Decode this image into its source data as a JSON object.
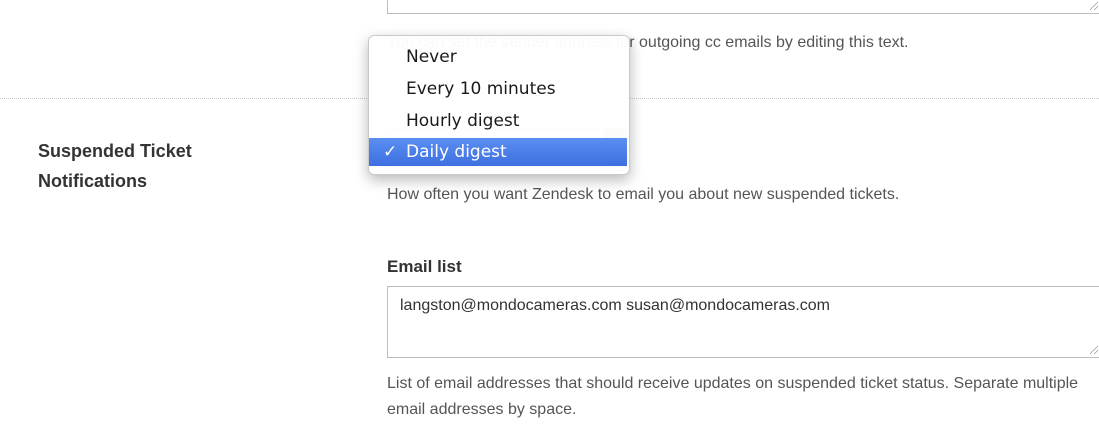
{
  "cc_help_text": "You can set the sender address for outgoing cc emails by editing this text.",
  "section_label": "Suspended Ticket Notifications",
  "notification_select": {
    "options": [
      {
        "label": "Never",
        "selected": false
      },
      {
        "label": "Every 10 minutes",
        "selected": false
      },
      {
        "label": "Hourly digest",
        "selected": false
      },
      {
        "label": "Daily digest",
        "selected": true
      }
    ],
    "checkmark": "✓"
  },
  "notification_help": "How often you want Zendesk to email you about new suspended tickets.",
  "email_list": {
    "label": "Email list",
    "value": "langston@mondocameras.com susan@mondocameras.com",
    "help": "List of email addresses that should receive updates on suspended ticket status. Separate multiple email addresses by space."
  },
  "colors": {
    "selected_bg": "#3d6fe0",
    "select_arrow": "#7fa83b"
  }
}
